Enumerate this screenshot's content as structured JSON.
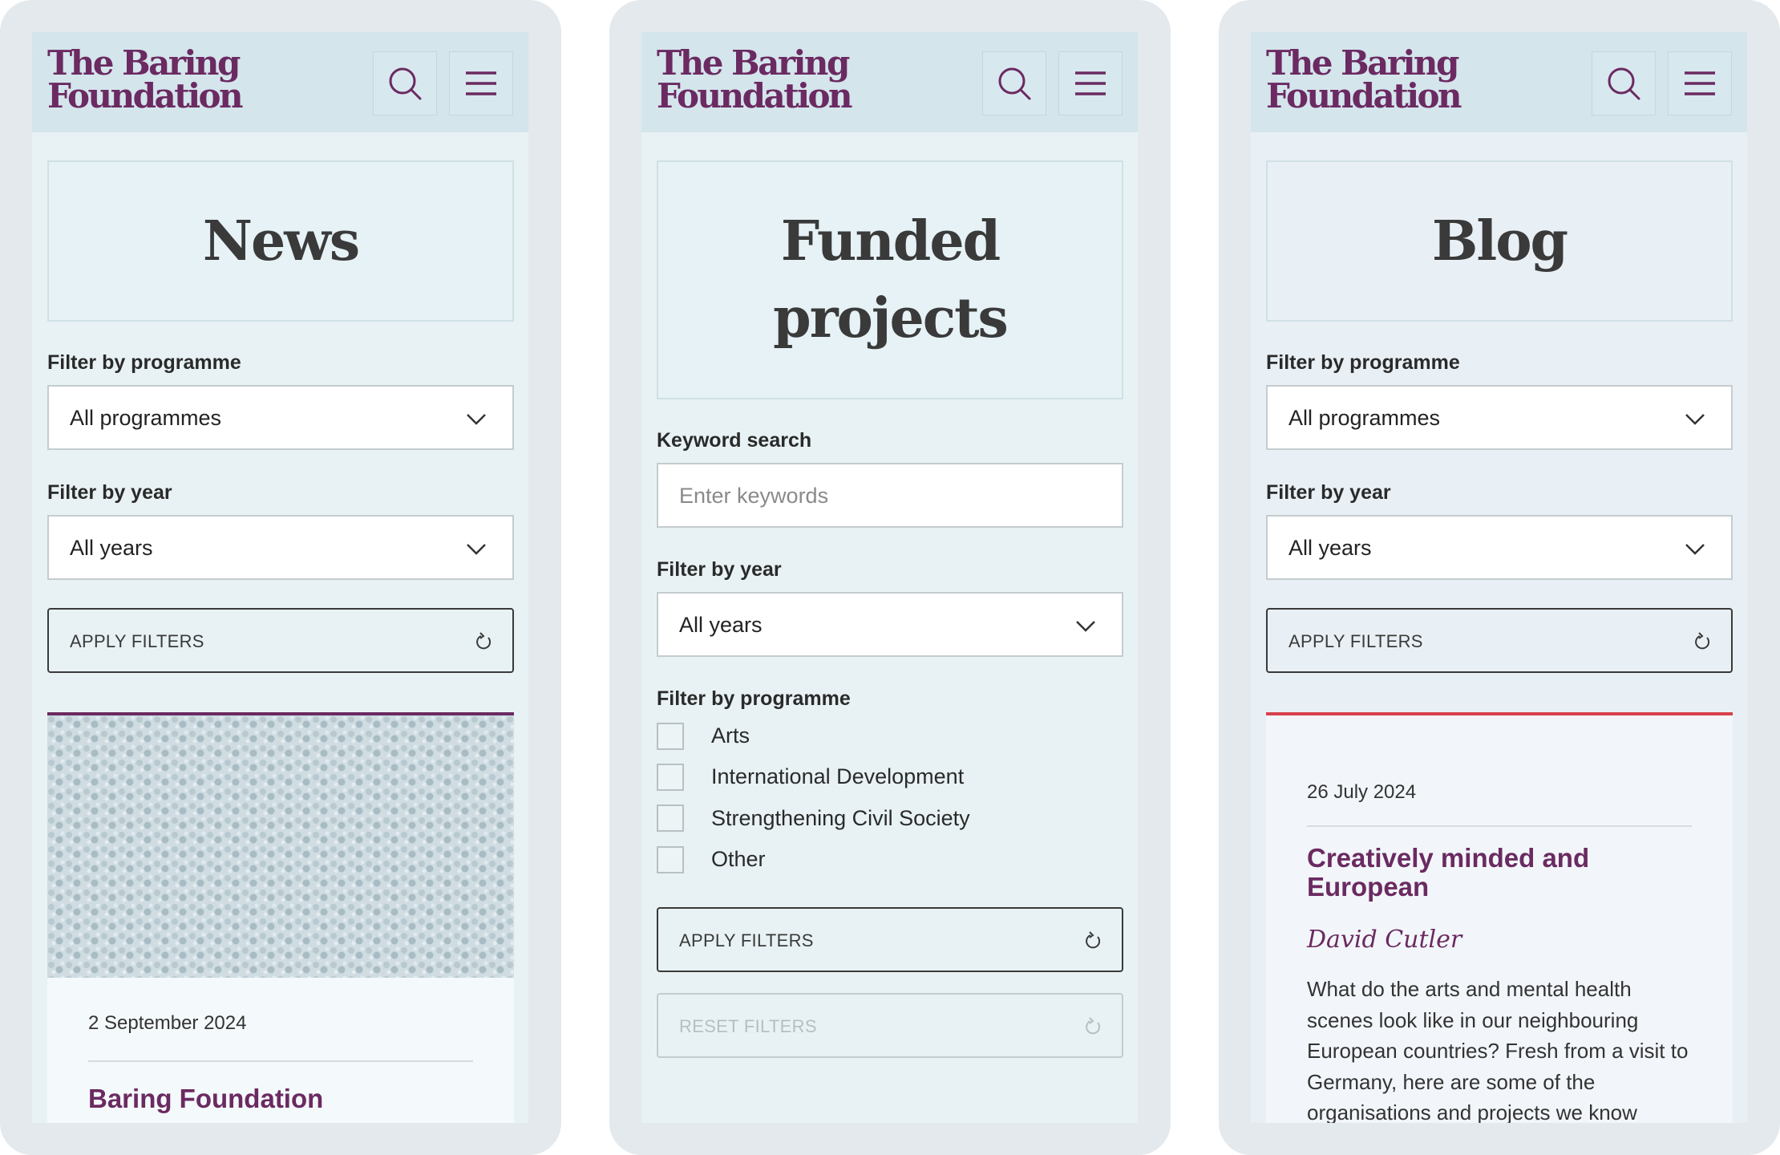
{
  "brand": {
    "line1": "The Baring",
    "line2": "Foundation",
    "color": "#6b2a61"
  },
  "header_icons": {
    "search": "search-icon",
    "menu": "hamburger-menu-icon"
  },
  "news_page": {
    "title": "News",
    "programme_filter": {
      "label": "Filter by programme",
      "value": "All programmes"
    },
    "year_filter": {
      "label": "Filter by year",
      "value": "All years"
    },
    "apply_label": "APPLY FILTERS",
    "card": {
      "date": "2 September 2024",
      "title": "Baring Foundation"
    }
  },
  "funded_page": {
    "title_line1": "Funded",
    "title_line2": "projects",
    "keyword": {
      "label": "Keyword search",
      "placeholder": "Enter keywords"
    },
    "year_filter": {
      "label": "Filter by year",
      "value": "All years"
    },
    "programme_label": "Filter by programme",
    "programmes": [
      "Arts",
      "International Development",
      "Strengthening Civil Society",
      "Other"
    ],
    "apply_label": "APPLY FILTERS",
    "reset_label": "RESET FILTERS"
  },
  "blog_page": {
    "title": "Blog",
    "programme_filter": {
      "label": "Filter by programme",
      "value": "All programmes"
    },
    "year_filter": {
      "label": "Filter by year",
      "value": "All years"
    },
    "apply_label": "APPLY FILTERS",
    "card": {
      "date": "26 July 2024",
      "title": "Creatively minded and European",
      "author": "David Cutler",
      "excerpt": "What do the arts and mental health scenes look like in our neighbouring European countries? Fresh from a visit to Germany, here are some of the organisations and projects we know about.",
      "accent": "#d9414b"
    }
  }
}
